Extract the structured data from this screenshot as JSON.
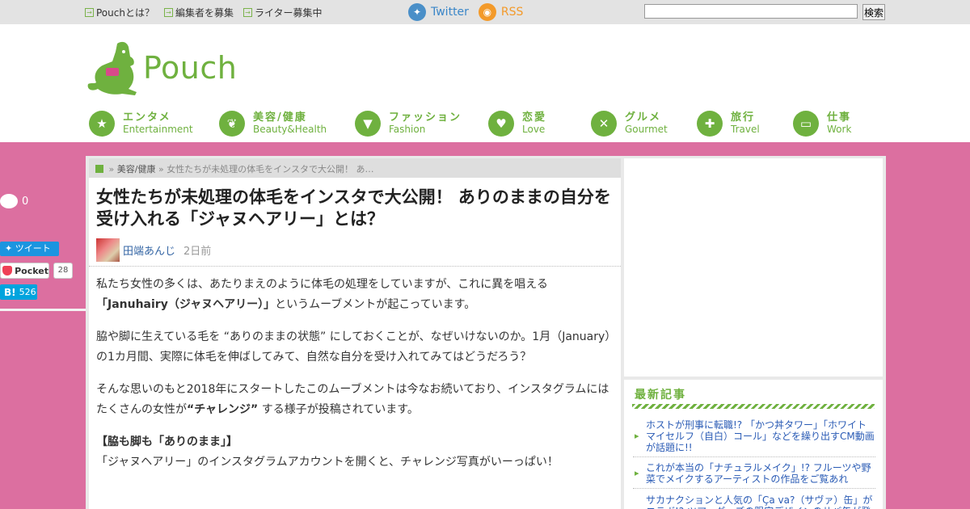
{
  "topbar": {
    "links": [
      "Pouchとは？",
      "編集者を募集",
      "ライター募集中"
    ],
    "twitter": "Twitter",
    "rss": "RSS",
    "search_button": "検索",
    "search_value": ""
  },
  "logo": {
    "text": "Pouch"
  },
  "nav": [
    {
      "jp": "エンタメ",
      "en": "Entertainment",
      "icon": "star"
    },
    {
      "jp": "美容/健康",
      "en": "Beauty&Health",
      "icon": "leaf"
    },
    {
      "jp": "ファッション",
      "en": "Fashion",
      "icon": "shirt"
    },
    {
      "jp": "恋愛",
      "en": "Love",
      "icon": "heart"
    },
    {
      "jp": "グルメ",
      "en": "Gourmet",
      "icon": "fork-knife"
    },
    {
      "jp": "旅行",
      "en": "Travel",
      "icon": "compass"
    },
    {
      "jp": "仕事",
      "en": "Work",
      "icon": "card"
    }
  ],
  "share": {
    "comments": "0",
    "tweet": "ツイート",
    "pocket": "Pocket",
    "pocket_count": "28",
    "hatena": "B!",
    "hatena_count": "526"
  },
  "breadcrumb": {
    "sep1": "»",
    "category": "美容/健康",
    "sep2": "»",
    "current": "女性たちが未処理の体毛をインスタで大公開！ あ…"
  },
  "article": {
    "title": "女性たちが未処理の体毛をインスタで大公開！ ありのままの自分を受け入れる「ジャヌヘアリー」とは？",
    "author": "田端あんじ",
    "time": "2日前",
    "p1_a": "私たち女性の多くは、あたりまえのように体毛の処理をしていますが、これに異を唱える",
    "p1_strong": "「Januhairy（ジャヌヘアリー）」",
    "p1_b": "というムーブメントが起こっています。",
    "p2": "脇や脚に生えている毛を “ありのままの状態” にしておくことが、なぜいけないのか。1月（January）の1カ月間、実際に体毛を伸ばしてみて、自然な自分を受け入れてみてはどうだろう？",
    "p3_a": "そんな思いのもと2018年にスタートしたこのムーブメントは今なお続いており、インスタグラムにはたくさんの女性が",
    "p3_strong": "“チャレンジ”",
    "p3_b": "する様子が投稿されています。",
    "h3": "【脇も脚も「ありのまま」】",
    "p4": "「ジャヌヘアリー」のインスタグラムアカウントを開くと、チャレンジ写真がいーっぱい！"
  },
  "sidebar": {
    "title": "最新記事",
    "items": [
      "ホストが刑事に転職!? 「かつ丼タワー」「ホワイトマイセルフ（自白）コール」などを繰り出すCM動画が話題に!!",
      "これが本当の「ナチュラルメイク」!? フルーツや野菜でメイクするアーティストの作品をご覧あれ",
      "サカナクションと人気の「Ça va?（サヴァ）缶」がコラボ!? ツアーグッズの限定デザインのサバ缶が登場"
    ]
  },
  "colors": {
    "brand_green": "#6fb13f",
    "pink_bg": "#dc6fa0",
    "link_blue": "#2a5bb5"
  }
}
